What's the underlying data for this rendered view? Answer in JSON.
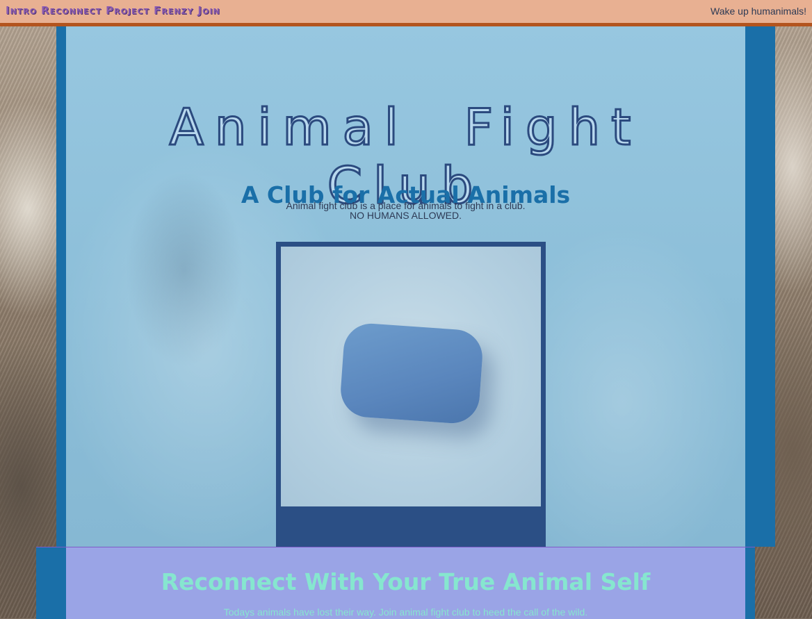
{
  "nav": {
    "items": [
      "Intro",
      "Reconnect",
      "Project",
      "Frenzy",
      "Join"
    ]
  },
  "tagline": "Wake up humanimals!",
  "hero": {
    "title": "Animal Fight Club",
    "subtitle": "A Club for Actual Animals",
    "text_line1": "Animal fight club is a place for animals to fight in a club.",
    "text_line2": "NO HUMANS ALLOWED."
  },
  "reconnect": {
    "title": "Reconnect With Your True Animal Self",
    "text": "Todays animals have lost their way. Join animal fight club to heed the call of the wild."
  },
  "colors": {
    "topbar": "#e8b092",
    "topbar_border": "#b3541e",
    "panel": "#1a6fa8",
    "reconnect_bg": "#9aa4e6",
    "reconnect_text": "#86e6cf"
  }
}
